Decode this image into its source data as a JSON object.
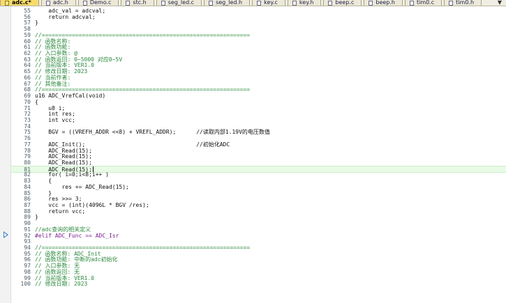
{
  "tabs": [
    {
      "label": "adc.c*",
      "active": true
    },
    {
      "label": "adc.h",
      "active": false
    },
    {
      "label": "Demo.c",
      "active": false
    },
    {
      "label": "stc.h",
      "active": false
    },
    {
      "label": "seg_led.c",
      "active": false
    },
    {
      "label": "seg_led.h",
      "active": false
    },
    {
      "label": "key.c",
      "active": false
    },
    {
      "label": "key.h",
      "active": false
    },
    {
      "label": "beep.c",
      "active": false
    },
    {
      "label": "beep.h",
      "active": false
    },
    {
      "label": "tim0.c",
      "active": false
    },
    {
      "label": "tim0.h",
      "active": false
    }
  ],
  "menu_arrow": "▼",
  "editor": {
    "current_line": "81",
    "lines": [
      {
        "n": "55",
        "t": "    adc_val = adcval;",
        "k": "code"
      },
      {
        "n": "56",
        "t": "    return adcval;",
        "k": "code"
      },
      {
        "n": "57",
        "t": "}",
        "k": "code"
      },
      {
        "n": "58",
        "t": "",
        "k": "code"
      },
      {
        "n": "59",
        "t": "//==============================================================",
        "k": "comment"
      },
      {
        "n": "60",
        "t": "// 函数名称:",
        "k": "comment"
      },
      {
        "n": "61",
        "t": "// 函数功能:",
        "k": "comment"
      },
      {
        "n": "62",
        "t": "// 入口参数: @",
        "k": "comment"
      },
      {
        "n": "63",
        "t": "// 函数返回: 0~5000 对应0~5V",
        "k": "comment"
      },
      {
        "n": "64",
        "t": "// 当前版本: VER1.0",
        "k": "comment"
      },
      {
        "n": "65",
        "t": "// 修改日期: 2023",
        "k": "comment"
      },
      {
        "n": "66",
        "t": "// 当前作者:",
        "k": "comment"
      },
      {
        "n": "67",
        "t": "// 其他备注:",
        "k": "comment"
      },
      {
        "n": "68",
        "t": "//==============================================================",
        "k": "comment"
      },
      {
        "n": "69",
        "t": "u16 ADC_VrefCal(void)",
        "k": "code"
      },
      {
        "n": "70",
        "t": "{",
        "k": "code"
      },
      {
        "n": "71",
        "t": "    u8 i;",
        "k": "code"
      },
      {
        "n": "72",
        "t": "    int res;",
        "k": "code"
      },
      {
        "n": "73",
        "t": "    int vcc;",
        "k": "code"
      },
      {
        "n": "74",
        "t": "",
        "k": "code"
      },
      {
        "n": "75",
        "t": "    BGV = ((VREFH_ADDR <<8) + VREFL_ADDR);      //读取内部1.19V的电压数值",
        "k": "code"
      },
      {
        "n": "76",
        "t": "",
        "k": "code"
      },
      {
        "n": "77",
        "t": "    ADC_Init();                                 //初始化ADC",
        "k": "code"
      },
      {
        "n": "78",
        "t": "    ADC_Read(15);",
        "k": "code"
      },
      {
        "n": "79",
        "t": "    ADC_Read(15);",
        "k": "code"
      },
      {
        "n": "80",
        "t": "    ADC_Read(15);",
        "k": "code"
      },
      {
        "n": "81",
        "t": "    ADC_Read(15);",
        "k": "current"
      },
      {
        "n": "82",
        "t": "    for( i=0;i<8;i++ )",
        "k": "code"
      },
      {
        "n": "83",
        "t": "    {",
        "k": "code"
      },
      {
        "n": "84",
        "t": "        res += ADC_Read(15);",
        "k": "code"
      },
      {
        "n": "85",
        "t": "    }",
        "k": "code"
      },
      {
        "n": "86",
        "t": "    res >>= 3;",
        "k": "code"
      },
      {
        "n": "87",
        "t": "    vcc = (int)(4096L * BGV /res);",
        "k": "code"
      },
      {
        "n": "88",
        "t": "    return vcc;",
        "k": "code"
      },
      {
        "n": "89",
        "t": "}",
        "k": "code"
      },
      {
        "n": "90",
        "t": "",
        "k": "code"
      },
      {
        "n": "91",
        "t": "//adc查询的相关定义",
        "k": "comment"
      },
      {
        "n": "92",
        "t": "#elif ADC_Func == ADC_Isr",
        "k": "pre"
      },
      {
        "n": "93",
        "t": "",
        "k": "code"
      },
      {
        "n": "94",
        "t": "//==============================================================",
        "k": "comment"
      },
      {
        "n": "95",
        "t": "// 函数名称: ADC_Init",
        "k": "comment"
      },
      {
        "n": "96",
        "t": "// 函数功能: 中断的adc初始化",
        "k": "comment"
      },
      {
        "n": "97",
        "t": "// 入口参数: 无",
        "k": "comment"
      },
      {
        "n": "98",
        "t": "// 函数返回: 无",
        "k": "comment"
      },
      {
        "n": "99",
        "t": "// 当前版本: VER1.0",
        "k": "comment"
      },
      {
        "n": "100",
        "t": "// 修改日期: 2023",
        "k": "comment"
      }
    ]
  }
}
